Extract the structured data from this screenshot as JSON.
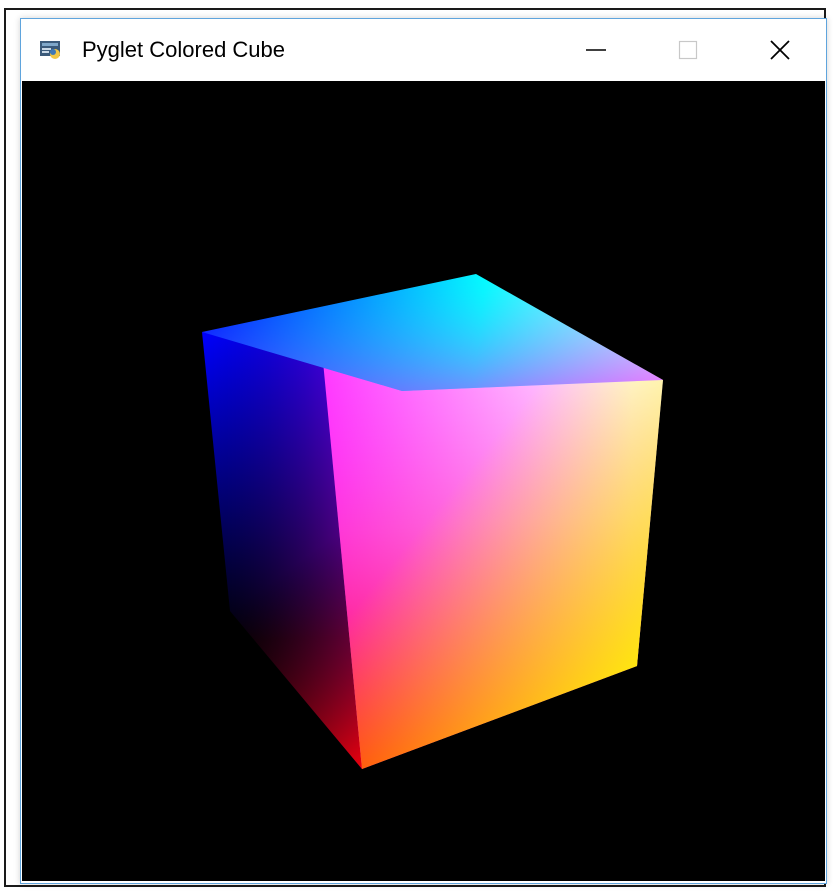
{
  "window": {
    "title": "Pyglet Colored Cube",
    "icon": "python-app-icon",
    "controls": {
      "minimize_icon": "minimize-icon",
      "maximize_icon": "maximize-icon",
      "close_icon": "close-icon"
    }
  },
  "scene": {
    "background": "#000000",
    "object": "colored-cube",
    "vertex_colors": {
      "top_back_left": "#0000ff",
      "top_back_right": "#00ffff",
      "top_front_right": "#ffffff",
      "top_front_left": "#ff00ff",
      "bottom_front_left": "#ff0000",
      "bottom_front_right": "#ffff00",
      "bottom_back_left": "#000000"
    }
  },
  "colors": {
    "window_border": "#5fa4dd",
    "titlebar_bg": "#ffffff",
    "title_text": "#000000"
  }
}
